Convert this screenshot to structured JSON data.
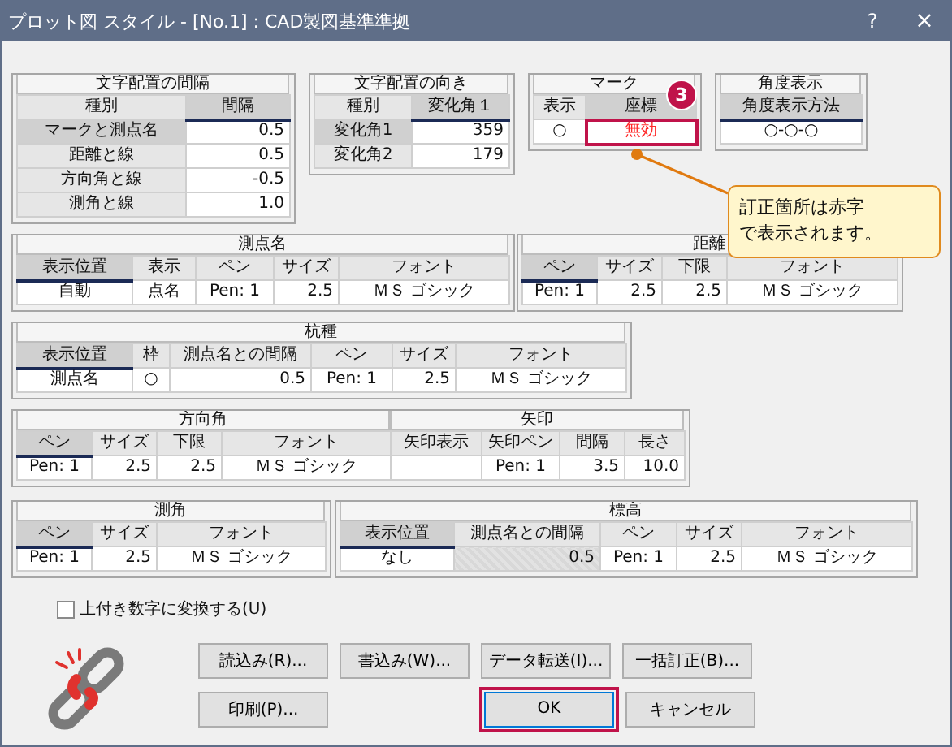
{
  "window": {
    "title": "プロット図 スタイル - [No.1] : CAD製図基準準拠",
    "help": "?",
    "close": "×"
  },
  "panels": [
    {
      "sections": [
        {
          "title": "文字配置の間隔",
          "columns": [
            {
              "label": "種別",
              "selected": false
            },
            {
              "label": "間隔",
              "selected": true
            }
          ]
        }
      ],
      "rows": [
        [
          {
            "text": "マークと測点名",
            "kind": "label",
            "selected": true
          },
          {
            "text": "0.5",
            "kind": "num"
          }
        ],
        [
          {
            "text": "距離と線",
            "kind": "label",
            "selected": false
          },
          {
            "text": "0.5",
            "kind": "num"
          }
        ],
        [
          {
            "text": "方向角と線",
            "kind": "label",
            "selected": false
          },
          {
            "text": "-0.5",
            "kind": "num"
          }
        ],
        [
          {
            "text": "測角と線",
            "kind": "label",
            "selected": false
          },
          {
            "text": "1.0",
            "kind": "num"
          }
        ]
      ]
    },
    {
      "sections": [
        {
          "title": "文字配置の向き",
          "columns": [
            {
              "label": "種別",
              "selected": false
            },
            {
              "label": "変化角１",
              "selected": true
            }
          ]
        }
      ],
      "rows": [
        [
          {
            "text": "変化角1",
            "kind": "label",
            "selected": true
          },
          {
            "text": "359",
            "kind": "num"
          }
        ],
        [
          {
            "text": "変化角2",
            "kind": "label",
            "selected": false
          },
          {
            "text": "179",
            "kind": "num"
          }
        ]
      ]
    },
    {
      "sections": [
        {
          "title": "マーク",
          "columns": [
            {
              "label": "表示",
              "selected": false
            },
            {
              "label": "座標",
              "selected": true
            }
          ]
        }
      ],
      "badge": "3",
      "rows": [
        [
          {
            "text": "○",
            "kind": "text"
          },
          {
            "text": "無効",
            "kind": "error",
            "highlighted": true
          }
        ]
      ]
    },
    {
      "sections": [
        {
          "title": "角度表示",
          "columns": [
            {
              "label": "角度表示方法",
              "selected": true
            }
          ]
        }
      ],
      "rows": [
        [
          {
            "text": "○-○-○",
            "kind": "text"
          }
        ]
      ]
    },
    {
      "sections": [
        {
          "title": "測点名",
          "columns": [
            {
              "label": "表示位置",
              "selected": true
            },
            {
              "label": "表示",
              "selected": false
            },
            {
              "label": "ペン",
              "selected": false
            },
            {
              "label": "サイズ",
              "selected": false
            },
            {
              "label": "フォント",
              "selected": false
            }
          ]
        }
      ],
      "rows": [
        [
          {
            "text": "自動",
            "kind": "text"
          },
          {
            "text": "点名",
            "kind": "text"
          },
          {
            "text": "Pen: 1",
            "kind": "text"
          },
          {
            "text": "2.5",
            "kind": "num"
          },
          {
            "text": "ＭＳ ゴシック",
            "kind": "text"
          }
        ]
      ]
    },
    {
      "sections": [
        {
          "title": "距離",
          "columns": [
            {
              "label": "ペン",
              "selected": true
            },
            {
              "label": "サイズ",
              "selected": false
            },
            {
              "label": "下限",
              "selected": false
            },
            {
              "label": "フォント",
              "selected": false
            }
          ]
        }
      ],
      "rows": [
        [
          {
            "text": "Pen: 1",
            "kind": "text"
          },
          {
            "text": "2.5",
            "kind": "num"
          },
          {
            "text": "2.5",
            "kind": "num"
          },
          {
            "text": "ＭＳ ゴシック",
            "kind": "text"
          }
        ]
      ]
    },
    {
      "sections": [
        {
          "title": "杭種",
          "columns": [
            {
              "label": "表示位置",
              "selected": true
            },
            {
              "label": "枠",
              "selected": false
            },
            {
              "label": "測点名との間隔",
              "selected": false
            },
            {
              "label": "ペン",
              "selected": false
            },
            {
              "label": "サイズ",
              "selected": false
            },
            {
              "label": "フォント",
              "selected": false
            }
          ]
        }
      ],
      "rows": [
        [
          {
            "text": "測点名",
            "kind": "text"
          },
          {
            "text": "○",
            "kind": "text"
          },
          {
            "text": "0.5",
            "kind": "num"
          },
          {
            "text": "Pen: 1",
            "kind": "text"
          },
          {
            "text": "2.5",
            "kind": "num"
          },
          {
            "text": "ＭＳ ゴシック",
            "kind": "text"
          }
        ]
      ]
    },
    {
      "sections": [
        {
          "title": "方向角",
          "columns": [
            {
              "label": "ペン",
              "selected": true
            },
            {
              "label": "サイズ",
              "selected": false
            },
            {
              "label": "下限",
              "selected": false
            },
            {
              "label": "フォント",
              "selected": false
            }
          ]
        },
        {
          "title": "矢印",
          "columns": [
            {
              "label": "矢印表示",
              "selected": false
            },
            {
              "label": "矢印ペン",
              "selected": false
            },
            {
              "label": "間隔",
              "selected": false
            },
            {
              "label": "長さ",
              "selected": false
            }
          ]
        }
      ],
      "rows": [
        [
          {
            "text": "Pen: 1",
            "kind": "text"
          },
          {
            "text": "2.5",
            "kind": "num"
          },
          {
            "text": "2.5",
            "kind": "num"
          },
          {
            "text": "ＭＳ ゴシック",
            "kind": "text"
          },
          {
            "kind": "empty"
          },
          {
            "text": "Pen: 1",
            "kind": "text"
          },
          {
            "text": "3.5",
            "kind": "num"
          },
          {
            "text": "10.0",
            "kind": "num"
          }
        ]
      ]
    },
    {
      "sections": [
        {
          "title": "測角",
          "columns": [
            {
              "label": "ペン",
              "selected": true
            },
            {
              "label": "サイズ",
              "selected": false
            },
            {
              "label": "フォント",
              "selected": false
            }
          ]
        }
      ],
      "rows": [
        [
          {
            "text": "Pen: 1",
            "kind": "text"
          },
          {
            "text": "2.5",
            "kind": "num"
          },
          {
            "text": "ＭＳ ゴシック",
            "kind": "text"
          }
        ]
      ]
    },
    {
      "sections": [
        {
          "title": "標高",
          "columns": [
            {
              "label": "表示位置",
              "selected": true
            },
            {
              "label": "測点名との間隔",
              "selected": false
            },
            {
              "label": "ペン",
              "selected": false
            },
            {
              "label": "サイズ",
              "selected": false
            },
            {
              "label": "フォント",
              "selected": false
            }
          ]
        }
      ],
      "rows": [
        [
          {
            "text": "なし",
            "kind": "text"
          },
          {
            "text": "0.5",
            "kind": "num",
            "disabled": true
          },
          {
            "text": "Pen: 1",
            "kind": "text"
          },
          {
            "text": "2.5",
            "kind": "num"
          },
          {
            "text": "ＭＳ ゴシック",
            "kind": "text"
          }
        ]
      ]
    }
  ],
  "callout": {
    "lines": [
      "訂正箇所は赤字",
      "で表示されます。"
    ]
  },
  "checkbox": {
    "label": "上付き数字に変換する(U)",
    "checked": false
  },
  "button_rows": [
    [
      {
        "label": "読込み(R)...",
        "highlighted": false
      },
      {
        "label": "書込み(W)...",
        "highlighted": false
      },
      {
        "label": "データ転送(I)...",
        "highlighted": false
      },
      {
        "label": "一括訂正(B)...",
        "highlighted": false
      }
    ],
    [
      {
        "label": "印刷(P)...",
        "highlighted": false
      },
      {
        "label": "OK",
        "highlighted": true
      },
      {
        "label": "キャンセル",
        "highlighted": false
      }
    ]
  ]
}
